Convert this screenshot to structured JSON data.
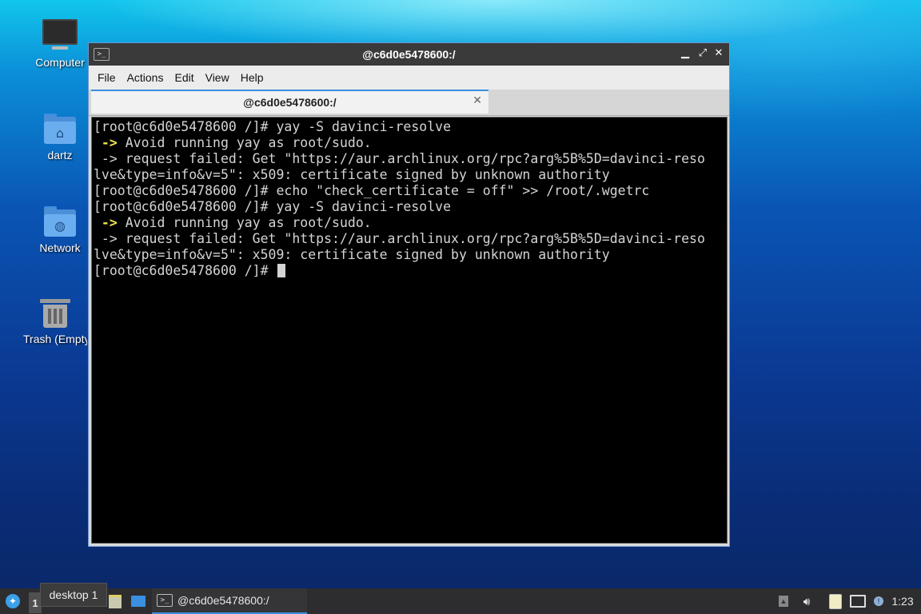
{
  "desktop": {
    "icons": [
      {
        "label": "Computer"
      },
      {
        "label": "dartz"
      },
      {
        "label": "Network"
      },
      {
        "label": "Trash (Empty)"
      }
    ]
  },
  "window": {
    "title": "@c6d0e5478600:/",
    "controls": {
      "minimize": "▁",
      "maximize": "⤢",
      "close": "✕"
    },
    "menu": [
      "File",
      "Actions",
      "Edit",
      "View",
      "Help"
    ],
    "tab": {
      "label": "@c6d0e5478600:/",
      "close": "✕"
    },
    "terminal": {
      "lines": [
        {
          "text": "[root@c6d0e5478600 /]# yay -S davinci-resolve"
        },
        {
          "arrow": " ->",
          "text": " Avoid running yay as root/sudo."
        },
        {
          "text": " -> request failed: Get \"https://aur.archlinux.org/rpc?arg%5B%5D=davinci-reso"
        },
        {
          "text": "lve&type=info&v=5\": x509: certificate signed by unknown authority"
        },
        {
          "text": "[root@c6d0e5478600 /]# echo \"check_certificate = off\" >> /root/.wgetrc"
        },
        {
          "text": "[root@c6d0e5478600 /]# yay -S davinci-resolve"
        },
        {
          "arrow": " ->",
          "text": " Avoid running yay as root/sudo."
        },
        {
          "text": " -> request failed: Get \"https://aur.archlinux.org/rpc?arg%5B%5D=davinci-reso"
        },
        {
          "text": "lve&type=info&v=5\": x509: certificate signed by unknown authority"
        }
      ],
      "prompt": "[root@c6d0e5478600 /]# "
    }
  },
  "taskbar": {
    "workspace": "1",
    "tooltip": "desktop 1",
    "task_label": "@c6d0e5478600:/",
    "clock": "1:23"
  },
  "colors": {
    "accent": "#3b8fe0",
    "terminal_bg": "#000000",
    "arrow": "#f0e54a"
  }
}
